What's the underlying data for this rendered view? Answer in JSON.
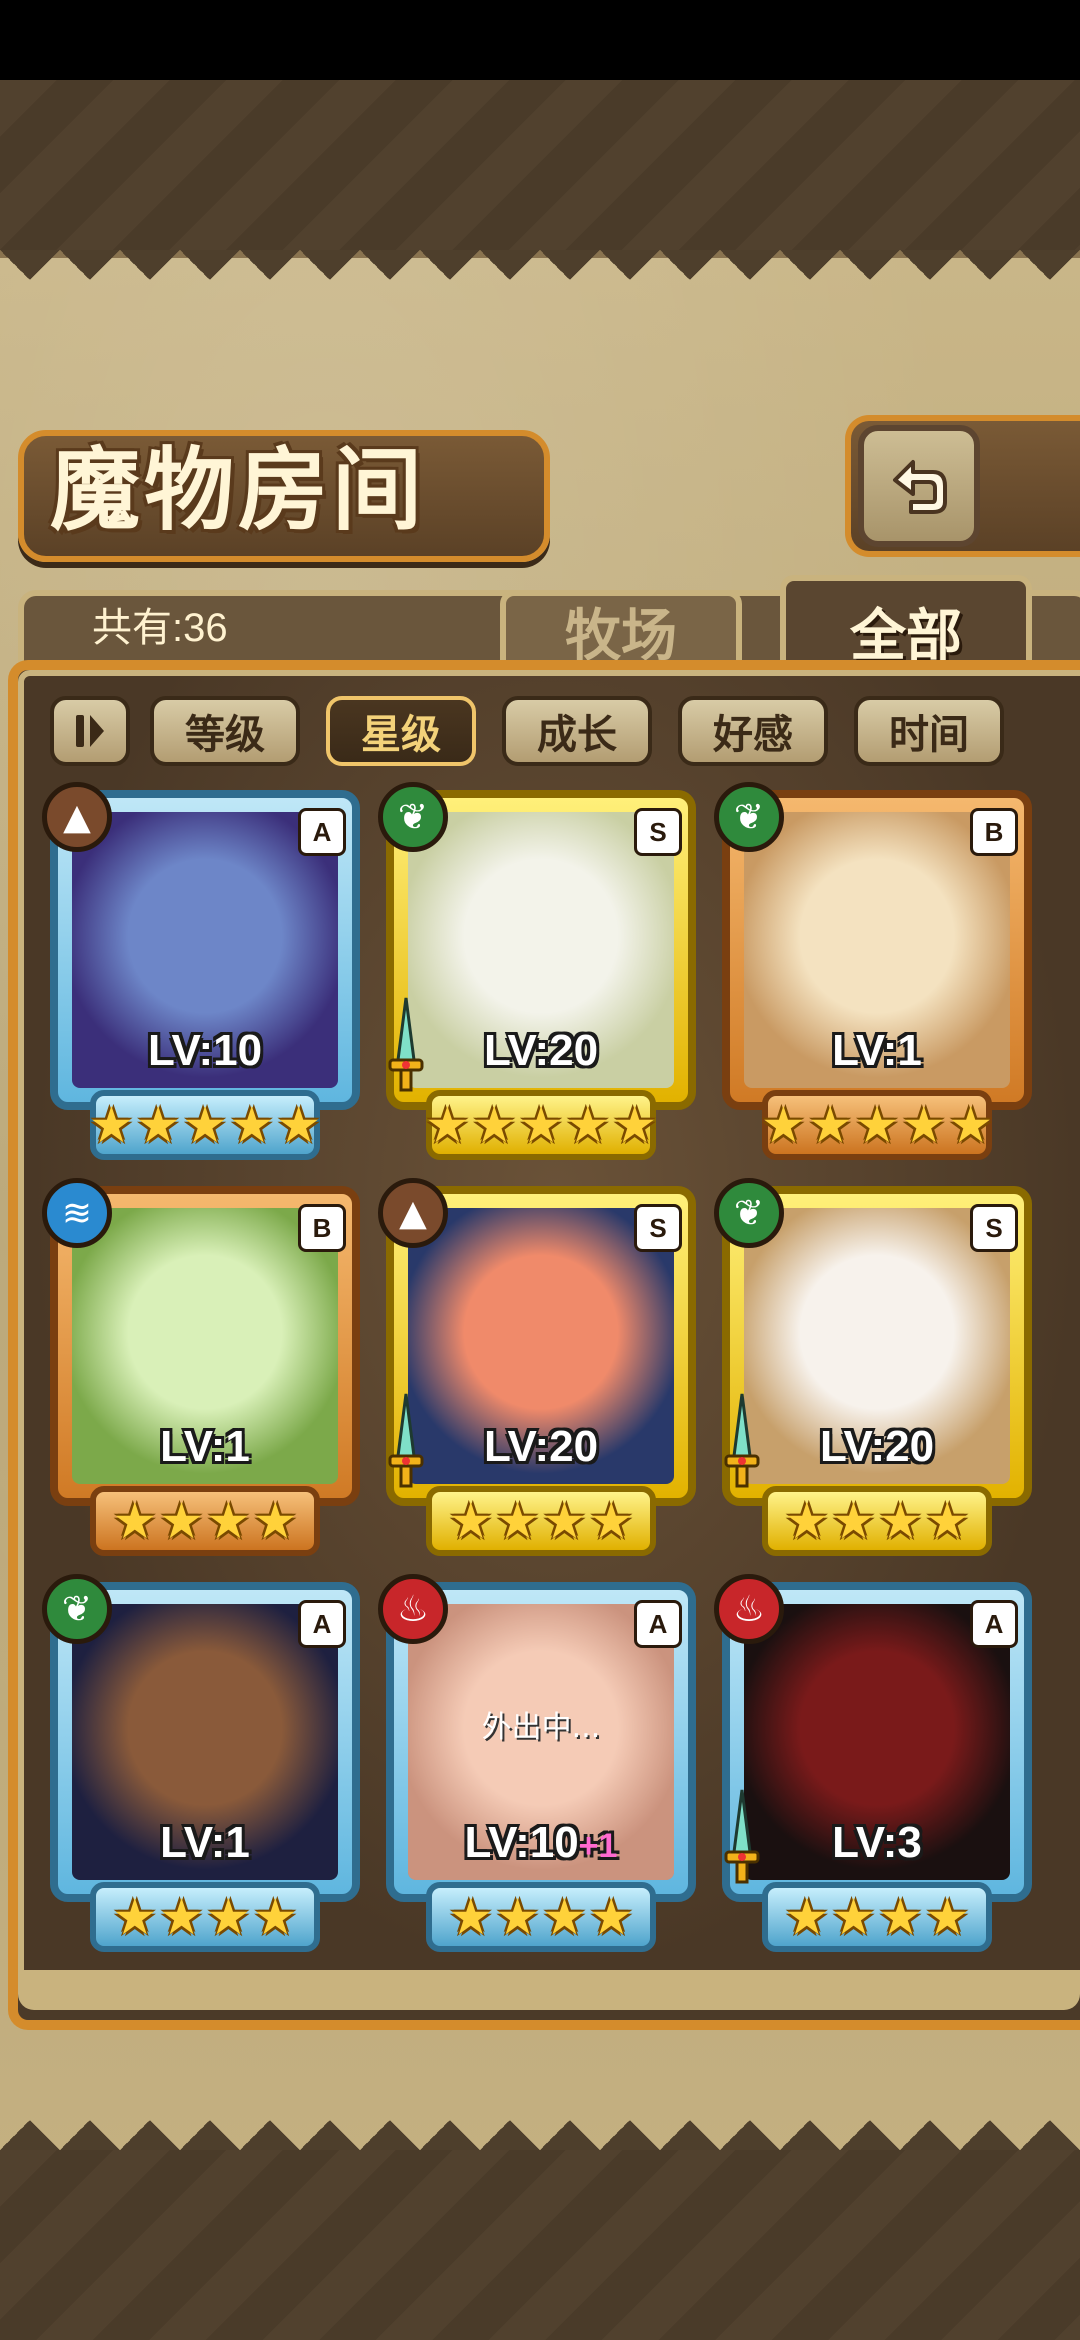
{
  "screen": {
    "title": "魔物房间",
    "count_label": "共有:36",
    "tabs": [
      {
        "label": "牧场",
        "active": false
      },
      {
        "label": "全部",
        "active": true
      }
    ],
    "sort_buttons": [
      {
        "label": "等级",
        "active": false
      },
      {
        "label": "星级",
        "active": true
      },
      {
        "label": "成长",
        "active": false
      },
      {
        "label": "好感",
        "active": false
      },
      {
        "label": "时间",
        "active": false
      }
    ]
  },
  "cards": [
    {
      "rank": "A",
      "element": "earth",
      "level": "LV:10",
      "bonus": "",
      "stars": 5,
      "away": "",
      "weapon": false,
      "portrait": [
        "#6d86c8",
        "#3b2f7a"
      ]
    },
    {
      "rank": "S",
      "element": "leaf",
      "level": "LV:20",
      "bonus": "",
      "stars": 5,
      "away": "",
      "weapon": true,
      "portrait": [
        "#f3f3ea",
        "#c9cfa3"
      ]
    },
    {
      "rank": "B",
      "element": "leaf",
      "level": "LV:1",
      "bonus": "",
      "stars": 5,
      "away": "",
      "weapon": false,
      "portrait": [
        "#f4e2c0",
        "#c99a63"
      ]
    },
    {
      "rank": "B",
      "element": "water",
      "level": "LV:1",
      "bonus": "",
      "stars": 4,
      "away": "",
      "weapon": false,
      "portrait": [
        "#d9f0b8",
        "#7ca94a"
      ]
    },
    {
      "rank": "S",
      "element": "earth",
      "level": "LV:20",
      "bonus": "",
      "stars": 4,
      "away": "",
      "weapon": true,
      "portrait": [
        "#f08a6a",
        "#29396a"
      ]
    },
    {
      "rank": "S",
      "element": "leaf",
      "level": "LV:20",
      "bonus": "",
      "stars": 4,
      "away": "",
      "weapon": true,
      "portrait": [
        "#f7f2ec",
        "#c7a06b"
      ]
    },
    {
      "rank": "A",
      "element": "leaf",
      "level": "LV:1",
      "bonus": "",
      "stars": 4,
      "away": "",
      "weapon": false,
      "portrait": [
        "#8a5a3a",
        "#1e2040"
      ]
    },
    {
      "rank": "A",
      "element": "fire",
      "level": "LV:10",
      "bonus": "+1",
      "stars": 4,
      "away": "外出中...",
      "weapon": false,
      "portrait": [
        "#f0b090",
        "#b05a3a"
      ]
    },
    {
      "rank": "A",
      "element": "fire",
      "level": "LV:3",
      "bonus": "",
      "stars": 4,
      "away": "",
      "weapon": true,
      "portrait": [
        "#7a1a1a",
        "#1a1010"
      ]
    }
  ],
  "colors": {
    "accent_orange": "#d48c2c",
    "panel_brown": "#4b3a28",
    "parchment": "#c9b688"
  },
  "icons": {
    "back": "back-arrow-icon",
    "sort_toggle": "sort-order-icon",
    "weapon": "sword-icon"
  }
}
